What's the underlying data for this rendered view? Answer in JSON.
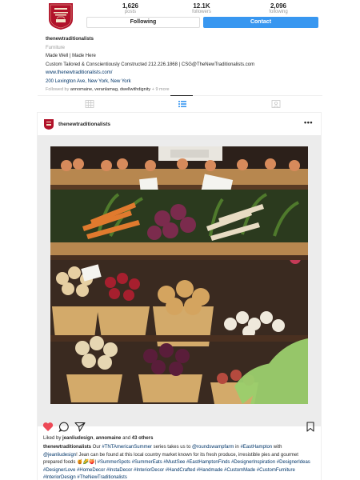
{
  "profile": {
    "stats": [
      {
        "value": "1,626",
        "label": "posts"
      },
      {
        "value": "12.1K",
        "label": "followers"
      },
      {
        "value": "2,096",
        "label": "following"
      }
    ],
    "following_label": "Following",
    "contact_label": "Contact",
    "username": "thenewtraditionalists",
    "category": "Furniture",
    "bio_line1": "Made Well | Made Here",
    "bio_line2": "Custom Tailored & Conscientiously Constructed 212.226.1868 | CSG@TheNewTraditionalists.com",
    "website": "www.thenewtraditionalists.com/",
    "address": "200 Lexington Ave, New York, New York",
    "followed_by_prefix": "Followed by",
    "followed_by_names": "annomaine, veranlamag, dwellwithdignity",
    "followed_by_more": "+ 9 more",
    "avatar_text": "THE NEW TRADITIONALISTS"
  },
  "tabs": [
    {
      "icon": "grid-icon"
    },
    {
      "icon": "list-icon",
      "active": true
    },
    {
      "icon": "tagged-icon"
    }
  ],
  "post": {
    "username": "thenewtraditionalists",
    "more_label": "•••",
    "actions": [
      "heart-icon",
      "comment-icon",
      "share-icon",
      "bookmark-icon"
    ],
    "liked_by_prefix": "Liked by",
    "liked_by_user": "jeanliudesign",
    "liked_by_joiner": ", ",
    "liked_by_user2": "annomaine",
    "liked_by_and": " and ",
    "liked_by_count": "43 others",
    "caption_user": "thenewtraditionalists",
    "caption_text1": " Our ",
    "caption_tag1": "#TNTAmericanSummer",
    "caption_text2": " series takes us to ",
    "caption_mention1": "@roundswampfarm",
    "caption_text3": " in ",
    "caption_tag2": "#EastHampton",
    "caption_text4": " with ",
    "caption_mention2": "@jeanliudesign",
    "caption_text5": "! Jean can be found at this local country market known for its fresh produce, irresistible pies and gourmet prepared foods 🍯🌽🍑| ",
    "caption_tags_line": "#SummerSpots #SummerEats #MustSee #EastHamptonFinds #DesignerInspiration #DesignerIdeas #DesignerLove #HomeDecor #InstaDecor #InteriorDecor #HandCrafted #Handmade #CustomMade #CustomFurniture #InteriorDesign #TheNewTraditionalists"
  },
  "colors": {
    "accent_blue": "#3897f0",
    "link": "#003569",
    "heart": "#ed4956",
    "brand_red": "#b1122a"
  }
}
